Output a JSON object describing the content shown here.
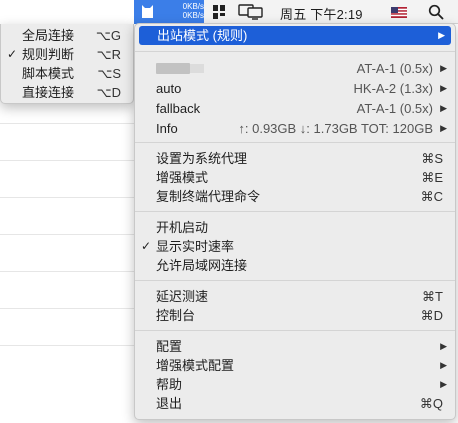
{
  "menubar": {
    "upload_speed": "0KB/s",
    "download_speed": "0KB/s",
    "datetime": "周五 下午2:19",
    "icons": [
      "clashx-cat-icon",
      "grid-icon",
      "display-icon",
      "flag-icon",
      "search-icon"
    ],
    "accent_color": "#3b7ee8"
  },
  "submenu": {
    "items": [
      {
        "label": "全局连接",
        "shortcut": "⌥G",
        "checked": false
      },
      {
        "label": "规则判断",
        "shortcut": "⌥R",
        "checked": true
      },
      {
        "label": "脚本模式",
        "shortcut": "⌥S",
        "checked": false
      },
      {
        "label": "直接连接",
        "shortcut": "⌥D",
        "checked": false
      }
    ]
  },
  "menu": {
    "outbound_mode": "出站模式 (规则)",
    "proxy_groups": [
      {
        "label": "",
        "value": "AT-A-1 (0.5x)",
        "redacted": true
      },
      {
        "label": "auto",
        "value": "HK-A-2 (1.3x)"
      },
      {
        "label": "fallback",
        "value": "AT-A-1 (0.5x)"
      },
      {
        "label": "Info",
        "value": "↑: 0.93GB ↓: 1.73GB TOT: 120GB"
      }
    ],
    "group2": [
      {
        "label": "设置为系统代理",
        "shortcut": "⌘S"
      },
      {
        "label": "增强模式",
        "shortcut": "⌘E"
      },
      {
        "label": "复制终端代理命令",
        "shortcut": "⌘C"
      }
    ],
    "group3": [
      {
        "label": "开机启动",
        "checked": false
      },
      {
        "label": "显示实时速率",
        "checked": true
      },
      {
        "label": "允许局域网连接",
        "checked": false
      }
    ],
    "group4": [
      {
        "label": "延迟测速",
        "shortcut": "⌘T"
      },
      {
        "label": "控制台",
        "shortcut": "⌘D"
      }
    ],
    "group5": [
      {
        "label": "配置",
        "submenu": true
      },
      {
        "label": "增强模式配置",
        "submenu": true
      },
      {
        "label": "帮助",
        "submenu": true
      },
      {
        "label": "退出",
        "shortcut": "⌘Q"
      }
    ],
    "check_mark": "✓",
    "arrow": "▶",
    "highlight_color": "#1d5fd8"
  }
}
